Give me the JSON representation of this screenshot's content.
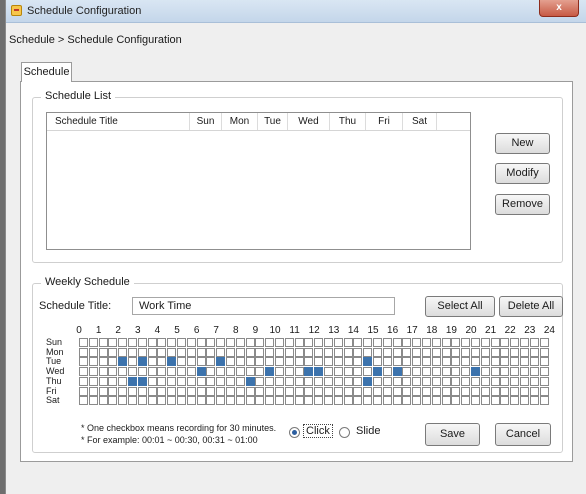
{
  "window": {
    "title": "Schedule Configuration",
    "close_glyph": "x"
  },
  "breadcrumb": "Schedule > Schedule Configuration",
  "tabs": [
    {
      "label": "Schedule"
    }
  ],
  "schedule_list": {
    "legend": "Schedule List",
    "columns": [
      "Schedule Title",
      "Sun",
      "Mon",
      "Tue",
      "Wed",
      "Thu",
      "Fri",
      "Sat"
    ],
    "rows": []
  },
  "list_buttons": {
    "new": "New",
    "modify": "Modify",
    "remove": "Remove"
  },
  "weekly": {
    "legend": "Weekly Schedule",
    "title_label": "Schedule Title:",
    "title_value": "Work Time",
    "select_all": "Select All",
    "delete_all": "Delete All",
    "hours": [
      "0",
      "1",
      "2",
      "3",
      "4",
      "5",
      "6",
      "7",
      "8",
      "9",
      "10",
      "11",
      "12",
      "13",
      "14",
      "15",
      "16",
      "17",
      "18",
      "19",
      "20",
      "21",
      "22",
      "23",
      "24"
    ],
    "days": [
      "Sun",
      "Mon",
      "Tue",
      "Wed",
      "Thu",
      "Fri",
      "Sat"
    ],
    "selected_slots": {
      "Tue": [
        4,
        6,
        9,
        14,
        29
      ],
      "Wed": [
        12,
        19,
        23,
        24,
        30,
        32,
        40
      ],
      "Thu": [
        5,
        6,
        17,
        29
      ]
    },
    "note_1": "* One checkbox means recording for 30 minutes.",
    "note_2": "* For example: 00:01 ~ 00:30, 00:31 ~ 01:00",
    "mode_options": [
      {
        "label": "Click",
        "selected": true
      },
      {
        "label": "Slide",
        "selected": false
      }
    ],
    "save": "Save",
    "cancel": "Cancel"
  },
  "colors": {
    "selected_cell": "#3c73ad",
    "titlebar": "#c9daed",
    "close_button": "#c75a44"
  }
}
